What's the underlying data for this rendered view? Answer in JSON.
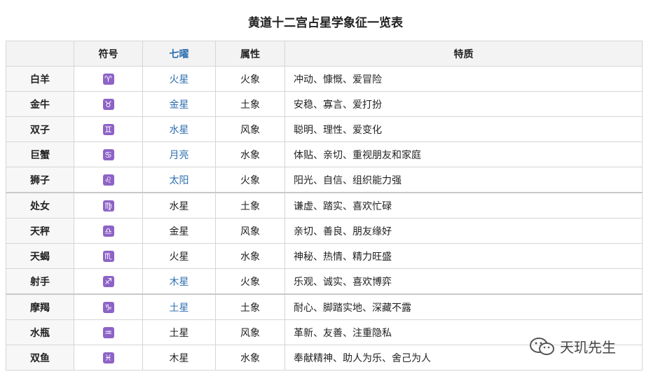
{
  "title": "黄道十二宫占星学象征一览表",
  "headers": [
    "",
    "符号",
    "七曜",
    "属性",
    "特质"
  ],
  "colors": {
    "link": "#2f6fb0",
    "symbol_bg": "#8e63c7",
    "header_bg": "#f3f3f3"
  },
  "rows": [
    {
      "name": "白羊",
      "symbol": "♈",
      "planet": "火星",
      "planet_link": true,
      "element": "火象",
      "trait": "冲动、慷慨、爱冒险"
    },
    {
      "name": "金牛",
      "symbol": "♉",
      "planet": "金星",
      "planet_link": true,
      "element": "土象",
      "trait": "安稳、寡言、爱打扮"
    },
    {
      "name": "双子",
      "symbol": "♊",
      "planet": "水星",
      "planet_link": true,
      "element": "风象",
      "trait": "聪明、理性、爱变化"
    },
    {
      "name": "巨蟹",
      "symbol": "♋",
      "planet": "月亮",
      "planet_link": true,
      "element": "水象",
      "trait": "体贴、亲切、重视朋友和家庭"
    },
    {
      "name": "狮子",
      "symbol": "♌",
      "planet": "太阳",
      "planet_link": true,
      "element": "火象",
      "trait": "阳光、自信、组织能力强"
    },
    {
      "name": "处女",
      "symbol": "♍",
      "planet": "水星",
      "planet_link": false,
      "element": "土象",
      "trait": "谦虚、踏实、喜欢忙碌"
    },
    {
      "name": "天秤",
      "symbol": "♎",
      "planet": "金星",
      "planet_link": false,
      "element": "风象",
      "trait": "亲切、善良、朋友缘好"
    },
    {
      "name": "天蝎",
      "symbol": "♏",
      "planet": "火星",
      "planet_link": false,
      "element": "水象",
      "trait": "神秘、热情、精力旺盛"
    },
    {
      "name": "射手",
      "symbol": "♐",
      "planet": "木星",
      "planet_link": true,
      "element": "火象",
      "trait": "乐观、诚实、喜欢博弈"
    },
    {
      "name": "摩羯",
      "symbol": "♑",
      "planet": "土星",
      "planet_link": true,
      "element": "土象",
      "trait": "耐心、脚踏实地、深藏不露"
    },
    {
      "name": "水瓶",
      "symbol": "♒",
      "planet": "土星",
      "planet_link": false,
      "element": "风象",
      "trait": "革新、友善、注重隐私"
    },
    {
      "name": "双鱼",
      "symbol": "♓",
      "planet": "木星",
      "planet_link": false,
      "element": "水象",
      "trait": "奉献精神、助人为乐、舍己为人"
    }
  ],
  "watermark": {
    "text": "天玑先生",
    "icon": "wechat-icon"
  }
}
